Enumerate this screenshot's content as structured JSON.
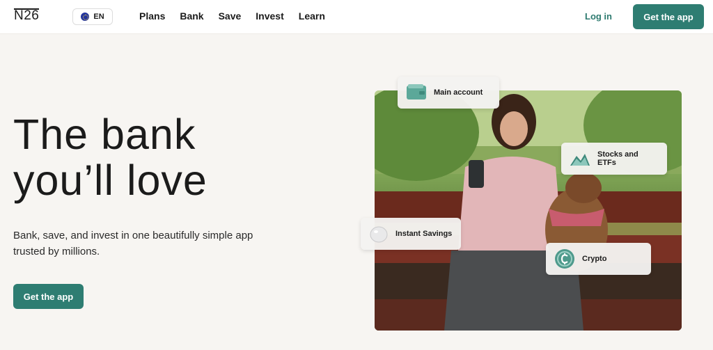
{
  "header": {
    "logo": "N26",
    "language": "EN",
    "nav": [
      "Plans",
      "Bank",
      "Save",
      "Invest",
      "Learn"
    ],
    "login_label": "Log in",
    "cta_label": "Get the app"
  },
  "hero": {
    "title_line1": "The bank",
    "title_line2": "you’ll love",
    "subtitle": "Bank, save, and invest in one beautifully simple app trusted by millions.",
    "cta_label": "Get the app"
  },
  "cards": {
    "main_account": "Main account",
    "stocks": "Stocks and ETFs",
    "savings": "Instant Savings",
    "crypto": "Crypto"
  },
  "icons": {
    "language": "globe-flag-icon",
    "main_account": "wallet-icon",
    "stocks": "mountain-chart-icon",
    "savings": "piggy-bank-icon",
    "crypto": "coin-icon"
  },
  "colors": {
    "brand_teal": "#2e7d72",
    "background": "#f7f5f2",
    "text": "#1b1b1b"
  }
}
